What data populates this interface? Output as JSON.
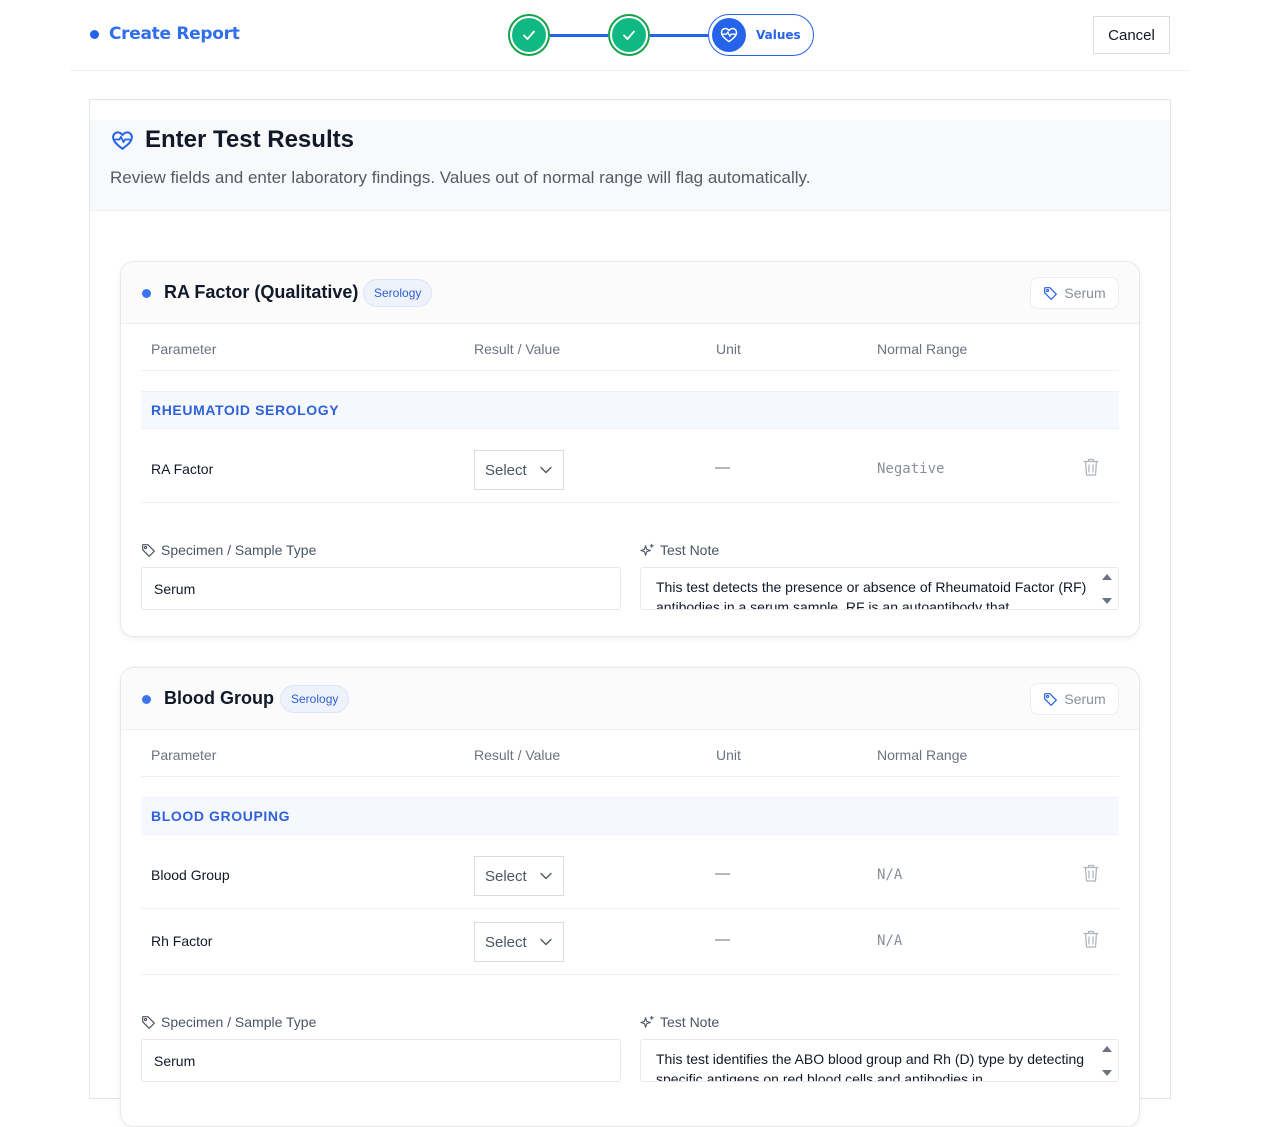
{
  "header": {
    "title": "Create Report",
    "active_step_label": "Values",
    "cancel_label": "Cancel"
  },
  "section": {
    "title": "Enter Test Results",
    "subtitle": "Review fields and enter laboratory findings. Values out of normal range will flag automatically."
  },
  "columns": {
    "parameter": "Parameter",
    "result": "Result / Value",
    "unit": "Unit",
    "range": "Normal Range"
  },
  "tests": [
    {
      "title": "RA Factor (Qualitative)",
      "category": "Serology",
      "specimen_chip": "Serum",
      "group": "RHEUMATOID SEROLOGY",
      "params": [
        {
          "name": "RA Factor",
          "select": "Select",
          "unit": "—",
          "range": "Negative"
        }
      ],
      "specimen_label": "Specimen / Sample Type",
      "specimen_value": "Serum",
      "note_label": "Test Note",
      "note_text": "This test detects the presence or absence of Rheumatoid Factor (RF) antibodies in a serum sample. RF is an autoantibody that"
    },
    {
      "title": "Blood Group",
      "category": "Serology",
      "specimen_chip": "Serum",
      "group": "BLOOD GROUPING",
      "params": [
        {
          "name": "Blood Group",
          "select": "Select",
          "unit": "—",
          "range": "N/A"
        },
        {
          "name": "Rh Factor",
          "select": "Select",
          "unit": "—",
          "range": "N/A"
        }
      ],
      "specimen_label": "Specimen / Sample Type",
      "specimen_value": "Serum",
      "note_label": "Test Note",
      "note_text": "This test identifies the ABO blood group and Rh (D) type by detecting specific antigens on red blood cells and antibodies in"
    }
  ],
  "colors": {
    "accent": "#2563eb",
    "success": "#10b981",
    "group_text": "#2f62d8"
  },
  "icons": [
    "check-icon",
    "heart-pulse-icon",
    "tag-icon",
    "sparkles-icon",
    "trash-icon",
    "chevron-down-icon"
  ]
}
